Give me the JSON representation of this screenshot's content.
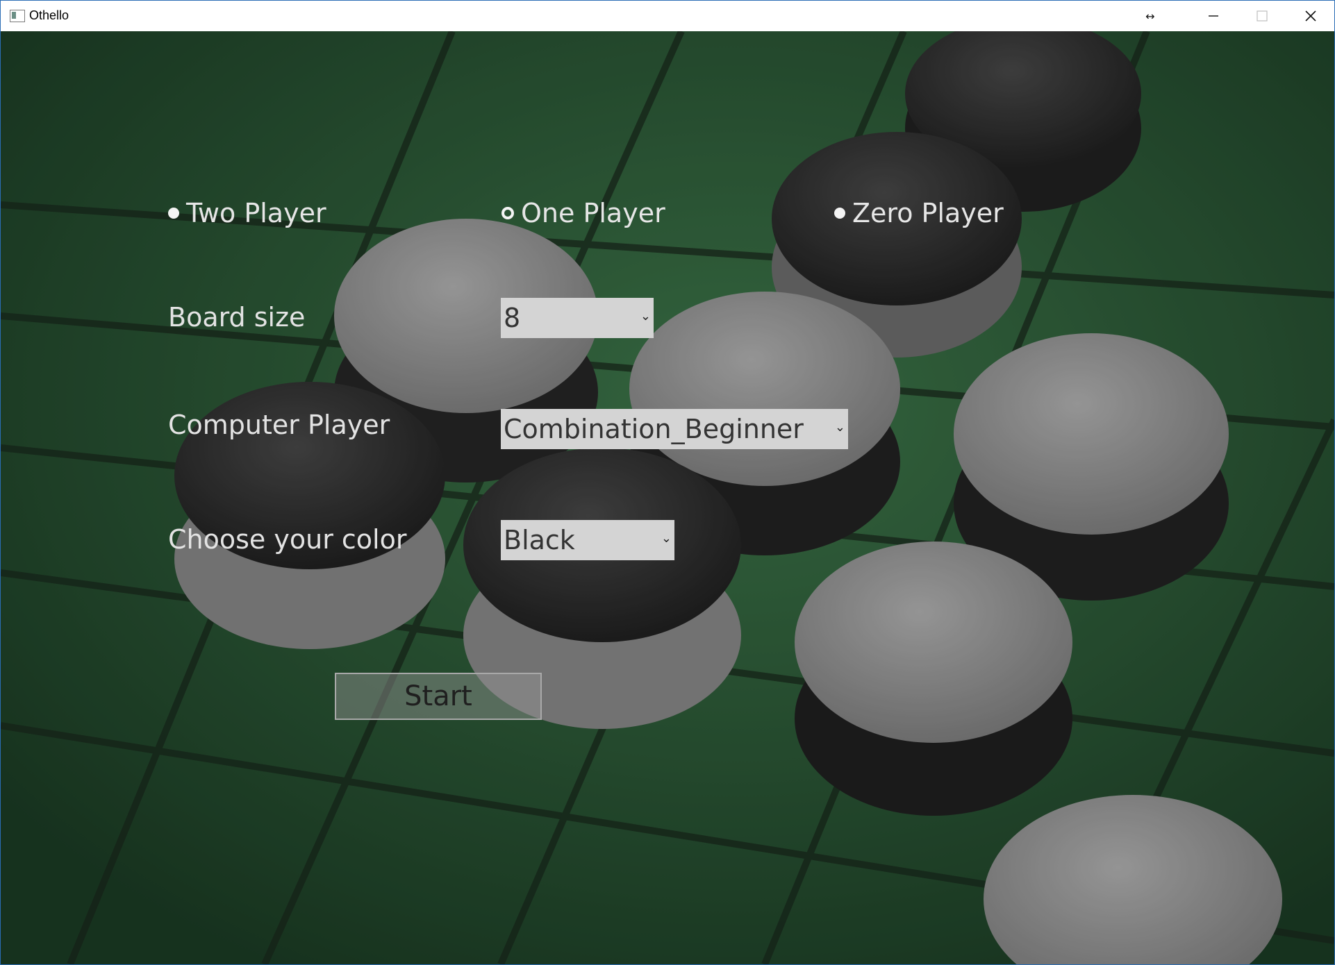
{
  "window": {
    "title": "Othello"
  },
  "controls": {
    "minimize_icon": "minimize-icon",
    "maximize_icon": "maximize-icon",
    "close_icon": "close-icon",
    "resize_icon": "resize-arrows-icon"
  },
  "mode_options": [
    {
      "label": "Two Player",
      "selected": false
    },
    {
      "label": "One Player",
      "selected": true
    },
    {
      "label": "Zero Player",
      "selected": false
    }
  ],
  "settings": {
    "board_size": {
      "label": "Board size",
      "value": "8"
    },
    "computer_player": {
      "label": "Computer Player",
      "value": "Combination_Beginner"
    },
    "color": {
      "label": "Choose your color",
      "value": "Black"
    }
  },
  "start_label": "Start",
  "colors": {
    "board_green": "#2c5c38",
    "overlay_gray": "#d4d4d4"
  }
}
